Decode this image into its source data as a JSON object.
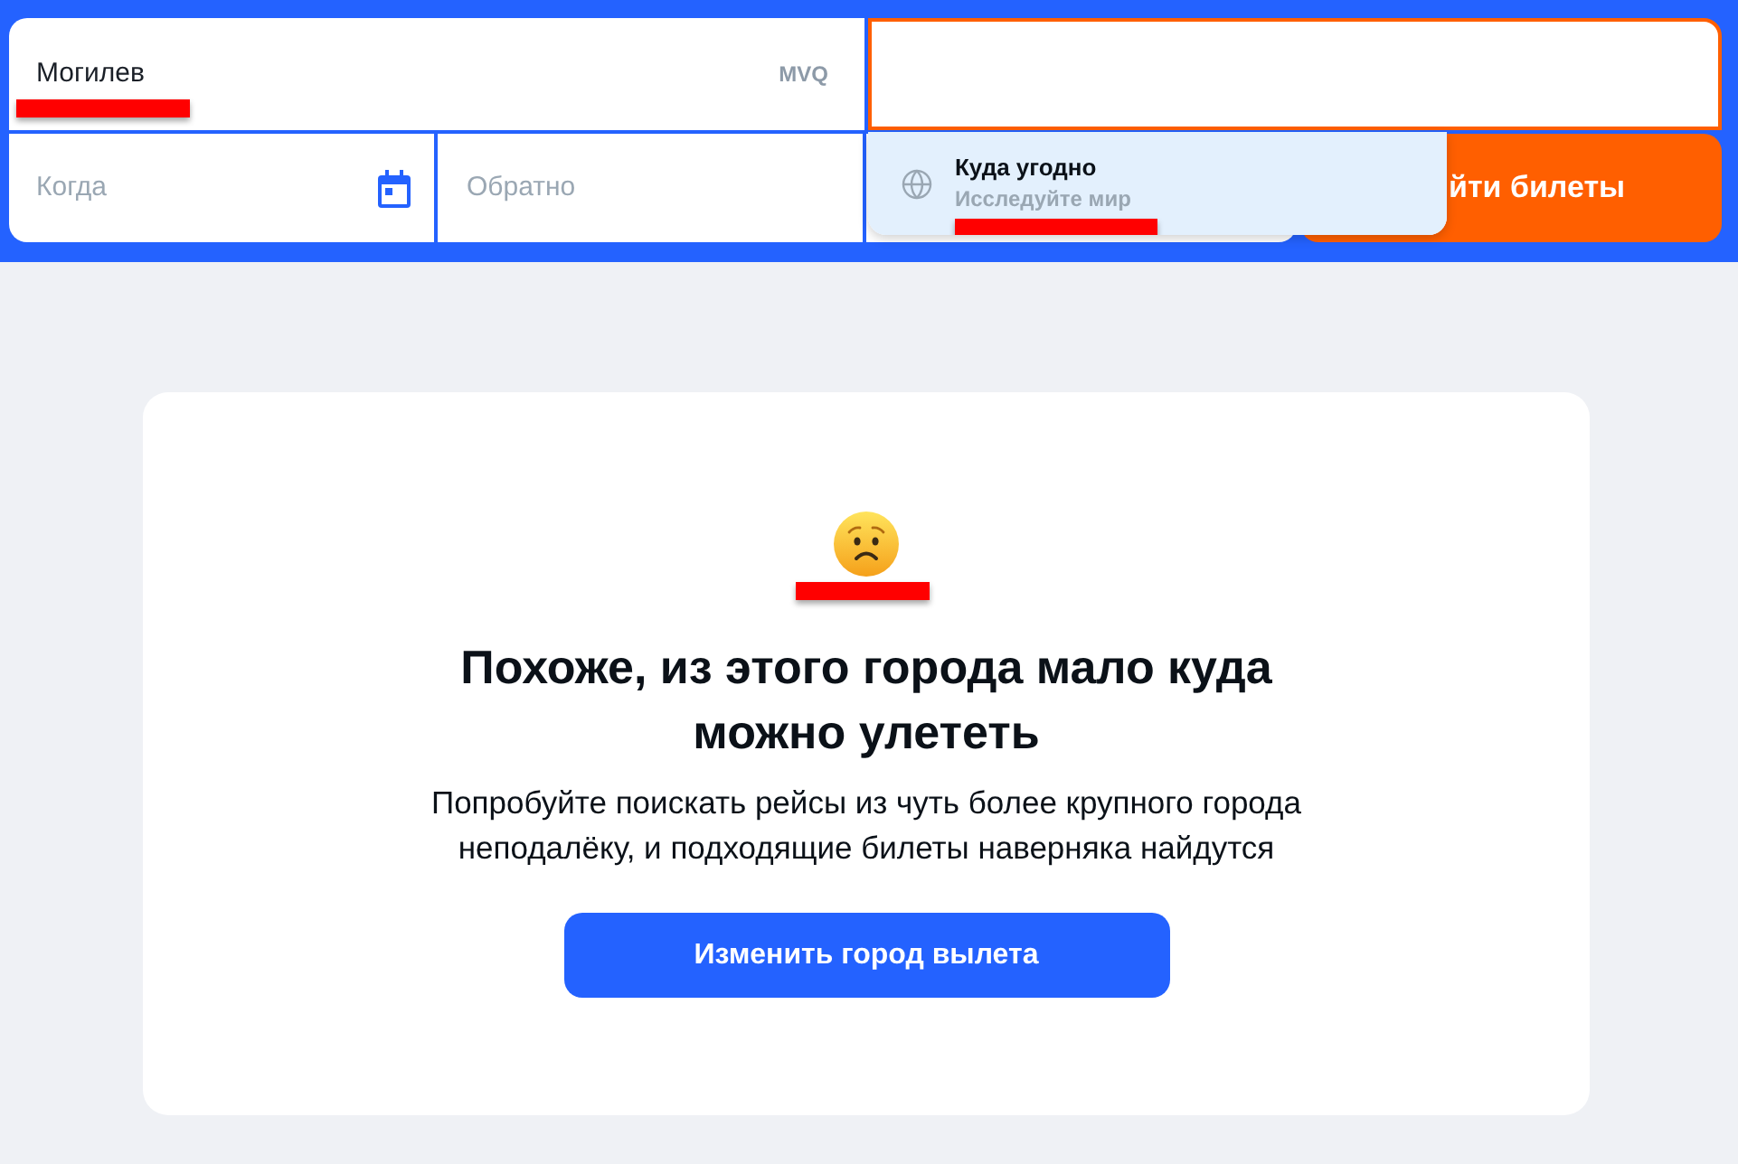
{
  "search_form": {
    "origin": {
      "value": "Могилев",
      "code": "MVQ",
      "underlined": true
    },
    "destination": {
      "focused": true
    },
    "depart_date": {
      "placeholder": "Когда"
    },
    "return_date": {
      "placeholder": "Обратно"
    },
    "search_button": {
      "label": "йти билеты"
    }
  },
  "destination_suggestions": [
    {
      "title": "Куда угодно",
      "subtitle": "Исследуйте мир",
      "selected": true,
      "subtitle_underlined": true
    }
  ],
  "empty_state": {
    "emoji_underlined": true,
    "title": "Похоже, из этого города мало куда можно улететь",
    "text": "Попробуйте поискать рейсы из чуть более крупного города неподалёку, и подходящие билеты наверняка найдутся",
    "button": "Изменить город вылета"
  }
}
